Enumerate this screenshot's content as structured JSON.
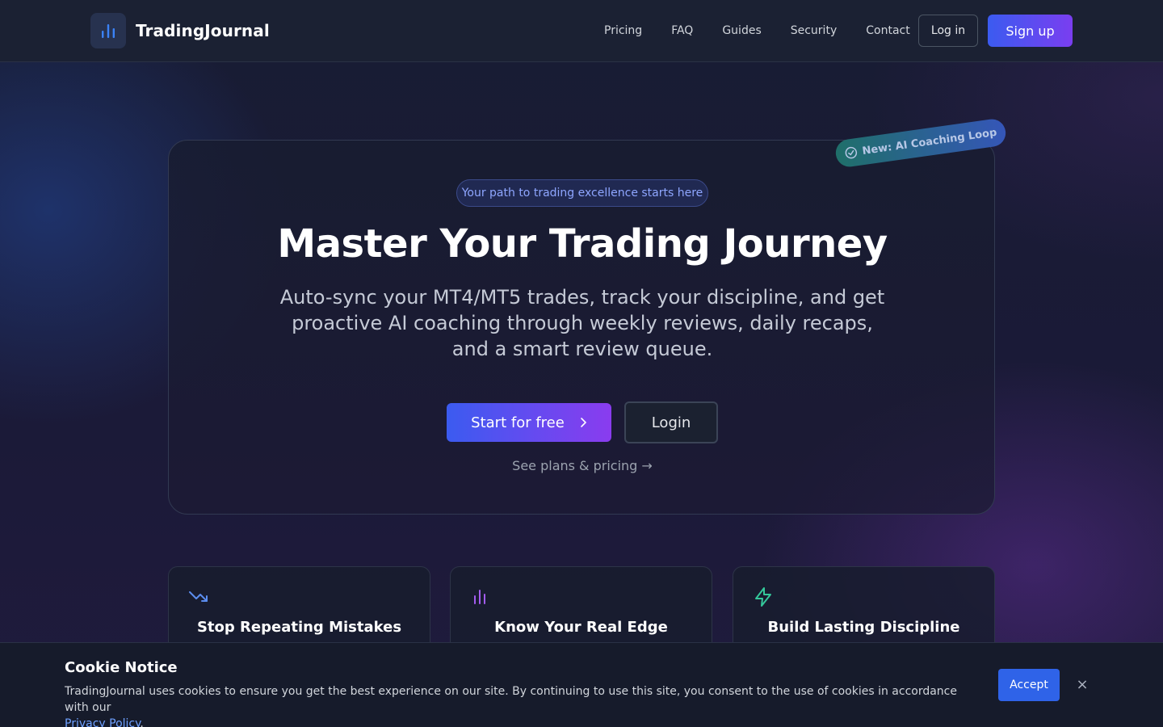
{
  "nav": {
    "brand": "TradingJournal",
    "links": [
      "Pricing",
      "FAQ",
      "Guides",
      "Security",
      "Contact"
    ],
    "login_label": "Log in",
    "signup_label": "Sign up"
  },
  "hero": {
    "pill": "Your path to trading excellence starts here",
    "title": "Master Your Trading Journey",
    "subtitle": "Auto-sync your MT4/MT5 trades, track your discipline, and get proactive AI coaching through weekly reviews, daily recaps, and a smart review queue.",
    "start_label": "Start for free",
    "login_label": "Login",
    "plans_link": "See plans & pricing →",
    "ribbon": "New: AI Coaching Loop"
  },
  "features": [
    {
      "title": "Stop Repeating Mistakes",
      "icon": "trending-down-icon",
      "color": "#5b8def"
    },
    {
      "title": "Know Your Real Edge",
      "icon": "bar-chart-icon",
      "color": "#a35cf0"
    },
    {
      "title": "Build Lasting Discipline",
      "icon": "zap-icon",
      "color": "#34c79a"
    }
  ],
  "cookie": {
    "title": "Cookie Notice",
    "text": "TradingJournal uses cookies to ensure you get the best experience on our site. By continuing to use this site, you consent to the use of cookies in accordance with our",
    "link": "Privacy Policy",
    "period": ".",
    "accept_label": "Accept",
    "close_glyph": "×"
  }
}
